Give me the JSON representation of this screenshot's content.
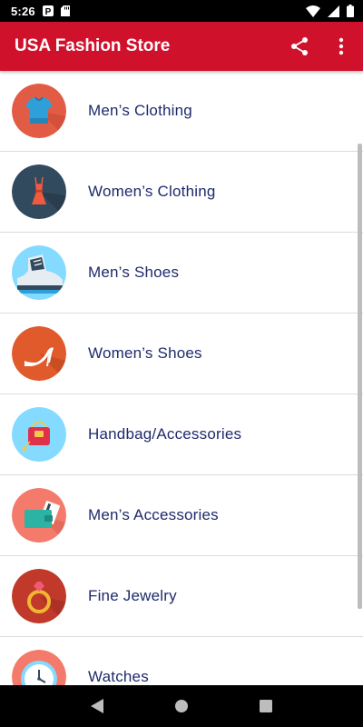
{
  "status_bar": {
    "time": "5:26",
    "icons": [
      "parking-icon",
      "sd-card-icon",
      "wifi-icon",
      "signal-icon",
      "battery-icon"
    ]
  },
  "app_bar": {
    "title": "USA Fashion Store",
    "actions": [
      "share-icon",
      "overflow-menu-icon"
    ]
  },
  "categories": [
    {
      "label": "Men’s Clothing",
      "icon": "shirt-icon",
      "color": "#e25c45"
    },
    {
      "label": "Women’s Clothing",
      "icon": "dress-icon",
      "color": "#324a5e"
    },
    {
      "label": "Men’s Shoes",
      "icon": "sneaker-icon",
      "color": "#84dbff"
    },
    {
      "label": "Women’s Shoes",
      "icon": "high-heel-icon",
      "color": "#e05a2b"
    },
    {
      "label": "Handbag/Accessories",
      "icon": "handbag-icon",
      "color": "#84dbff"
    },
    {
      "label": "Men’s Accessories",
      "icon": "wallet-icon",
      "color": "#f47b6b"
    },
    {
      "label": "Fine Jewelry",
      "icon": "ring-icon",
      "color": "#c0392b"
    },
    {
      "label": "Watches",
      "icon": "clock-icon",
      "color": "#f47b6b"
    }
  ],
  "nav_bar": {
    "buttons": [
      "back-icon",
      "home-icon",
      "recents-icon"
    ]
  },
  "colors": {
    "app_bar": "#d0112b",
    "label_text": "#1f2a6b",
    "divider": "#dcdcdc"
  }
}
